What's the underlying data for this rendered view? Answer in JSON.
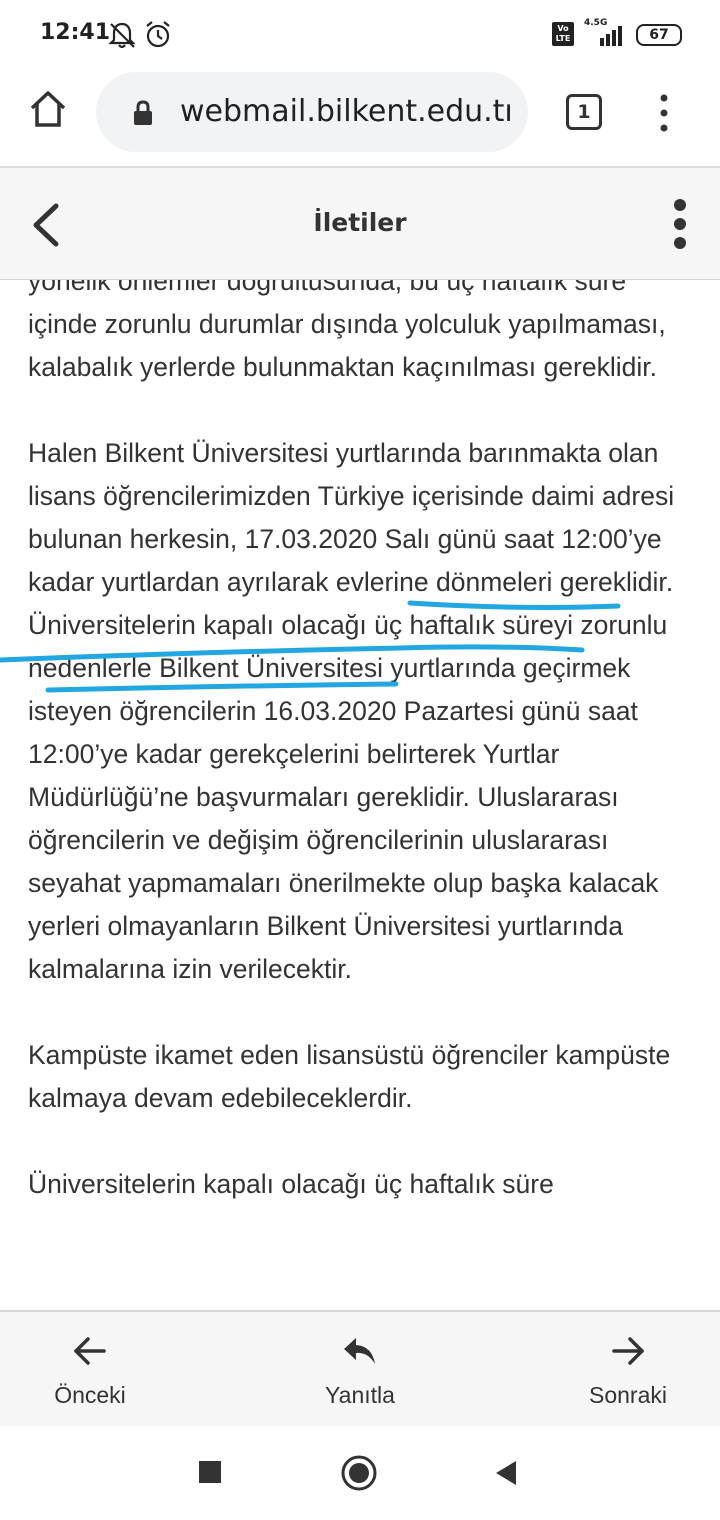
{
  "status_bar": {
    "time": "12:41",
    "network_type": "4.5G",
    "volte_label": "Vo LTE",
    "battery_level": "67",
    "icons": [
      "notifications-off-icon",
      "alarm-icon",
      "volte-icon",
      "signal-icon",
      "battery-icon"
    ]
  },
  "browser": {
    "url": "webmail.bilkent.edu.tr/",
    "tab_count": "1",
    "icons": [
      "home-icon",
      "lock-icon",
      "more-vert-icon"
    ]
  },
  "app_header": {
    "title": "İletiler",
    "icons": [
      "back-chevron-icon",
      "more-vert-icon"
    ]
  },
  "message": {
    "paragraphs": [
      "yönelik önlemler doğrultusunda, bu üç haftalık süre içinde zorunlu durumlar dışında yolculuk yapılmaması, kalabalık yerlerde bulunmaktan kaçınılması gereklidir.",
      {
        "before": "Halen Bilkent Üniversitesi yurtlarında barınmakta olan lisans öğrencilerimizden Türkiye içerisinde daimi adresi bulunan herkesin, ",
        "highlight": "17.03.2020 Salı günü saat 12:00’ye kadar yurtlardan ayrılarak evlerine dönmeleri gereklidir",
        "after": ". Üniversitelerin kapalı olacağı üç haftalık süreyi zorunlu nedenlerle Bilkent Üniversitesi yurtlarında geçirmek isteyen öğrencilerin 16.03.2020 Pazartesi günü saat 12:00’ye kadar gerekçelerini belirterek Yurtlar Müdürlüğü’ne başvurmaları gereklidir. Uluslararası öğrencilerin ve değişim öğrencilerinin uluslararası seyahat yapmamaları önerilmekte olup başka kalacak yerleri olmayanların Bilkent Üniversitesi yurtlarında kalmalarına izin verilecektir."
      },
      "Kampüste ikamet eden lisansüstü öğrenciler kampüste kalmaya devam edebileceklerdir.",
      "Üniversitelerin kapalı olacağı üç haftalık süre"
    ]
  },
  "actions": {
    "previous": "Önceki",
    "reply": "Yanıtla",
    "next": "Sonraki",
    "icons": [
      "arrow-left-icon",
      "reply-icon",
      "arrow-right-icon"
    ]
  },
  "nav_bar": {
    "icons": [
      "recents-square-icon",
      "home-circle-icon",
      "back-triangle-icon"
    ]
  },
  "colors": {
    "annotation_ink": "#22a7e0",
    "header_bg": "#f6f6f6",
    "url_pill_bg": "#f1f3f4"
  }
}
